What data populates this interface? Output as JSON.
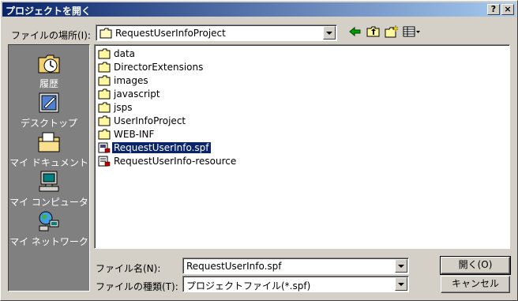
{
  "window": {
    "title": "プロジェクトを開く",
    "help_glyph": "?",
    "close_glyph": "×"
  },
  "location": {
    "label": "ファイルの場所(I):",
    "current_folder": "RequestUserInfoProject"
  },
  "places": [
    {
      "label": "履歴",
      "icon": "history-icon"
    },
    {
      "label": "デスクトップ",
      "icon": "desktop-icon"
    },
    {
      "label": "マイ ドキュメント",
      "icon": "my-documents-icon"
    },
    {
      "label": "マイ コンピュータ",
      "icon": "my-computer-icon"
    },
    {
      "label": "マイ ネットワーク",
      "icon": "my-network-icon"
    }
  ],
  "files": [
    {
      "name": "data",
      "type": "folder"
    },
    {
      "name": "DirectorExtensions",
      "type": "folder"
    },
    {
      "name": "images",
      "type": "folder"
    },
    {
      "name": "javascript",
      "type": "folder"
    },
    {
      "name": "jsps",
      "type": "folder"
    },
    {
      "name": "UserInfoProject",
      "type": "folder"
    },
    {
      "name": "WEB-INF",
      "type": "folder"
    },
    {
      "name": "RequestUserInfo.spf",
      "type": "project-file",
      "selected": true
    },
    {
      "name": "RequestUserInfo-resource",
      "type": "resource-file"
    }
  ],
  "filename": {
    "label": "ファイル名(N):",
    "value": "RequestUserInfo.spf"
  },
  "filetype": {
    "label": "ファイルの種類(T):",
    "value": "プロジェクトファイル(*.spf)"
  },
  "buttons": {
    "open": "開く(O)",
    "cancel": "キャンセル"
  },
  "colors": {
    "selection": "#0a246a",
    "dialog_face": "#d4d0c8",
    "places_bar": "#808080"
  }
}
